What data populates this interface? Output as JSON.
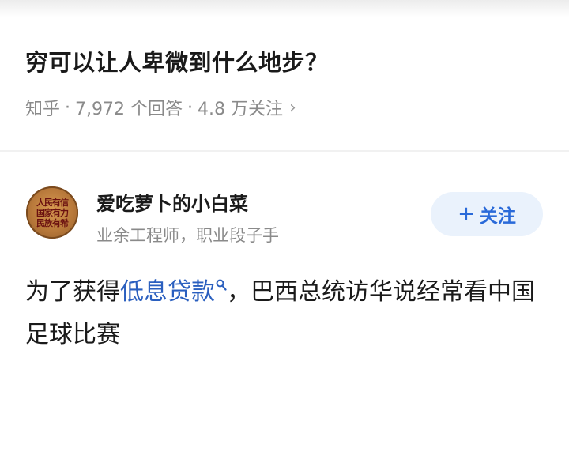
{
  "question": {
    "title": "穷可以让人卑微到什么地步？",
    "source": "知乎",
    "answers": "7,972 个回答",
    "followers": "4.8 万关注",
    "separator": "·",
    "chevron": "›"
  },
  "author": {
    "name": "爱吃萝卜的小白菜",
    "bio": "业余工程师，职业段子手",
    "avatar_text": [
      "人民有信",
      "国家有力",
      "民族有希"
    ]
  },
  "follow_button": {
    "plus": "+",
    "label": "关注"
  },
  "answer": {
    "text_before": "为了获得",
    "keyword": "低息贷款",
    "keyword_icon": "search-icon",
    "text_after": "，巴西总统访华说经常看中国足球比赛"
  },
  "colors": {
    "keyword": "#2a5fbf",
    "follow_bg": "#eaf2fc",
    "follow_text": "#2a6ad9",
    "meta_text": "#8a8a8a"
  }
}
